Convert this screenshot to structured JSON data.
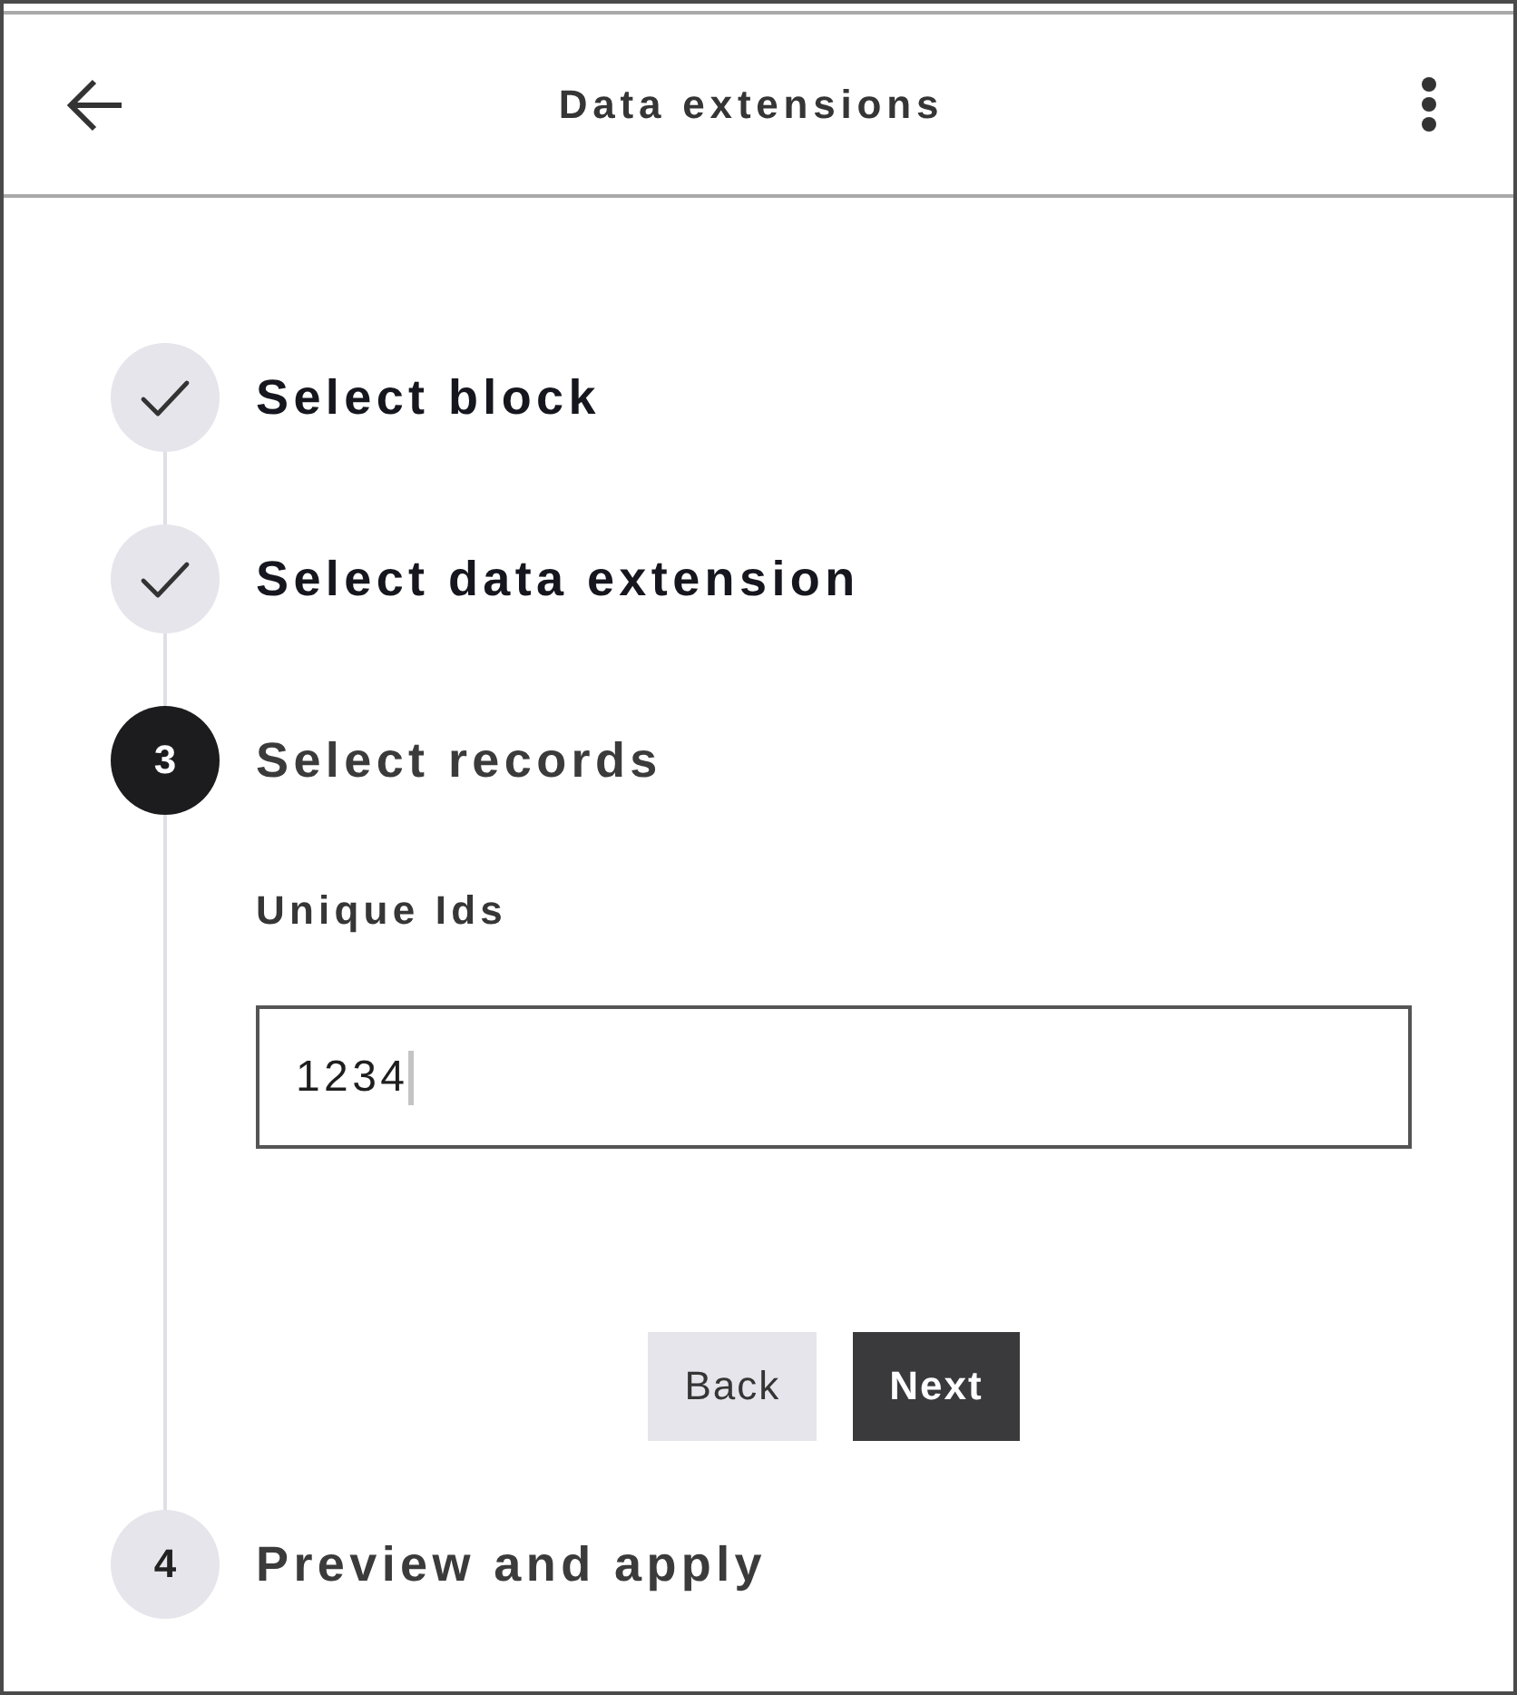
{
  "header": {
    "title": "Data extensions"
  },
  "steps": [
    {
      "title": "Select block",
      "completed": true,
      "selected": false
    },
    {
      "title": "Select data extension",
      "completed": true,
      "selected": false
    },
    {
      "number": "3",
      "title": "Select records",
      "completed": false,
      "selected": true,
      "field": {
        "label": "Unique Ids",
        "value": "1234",
        "focused": true
      },
      "buttons": [
        {
          "label": "Back",
          "kind": "secondary"
        },
        {
          "label": "Next",
          "kind": "primary"
        }
      ]
    },
    {
      "number": "4",
      "title": "Preview and apply",
      "completed": false,
      "selected": false
    }
  ]
}
